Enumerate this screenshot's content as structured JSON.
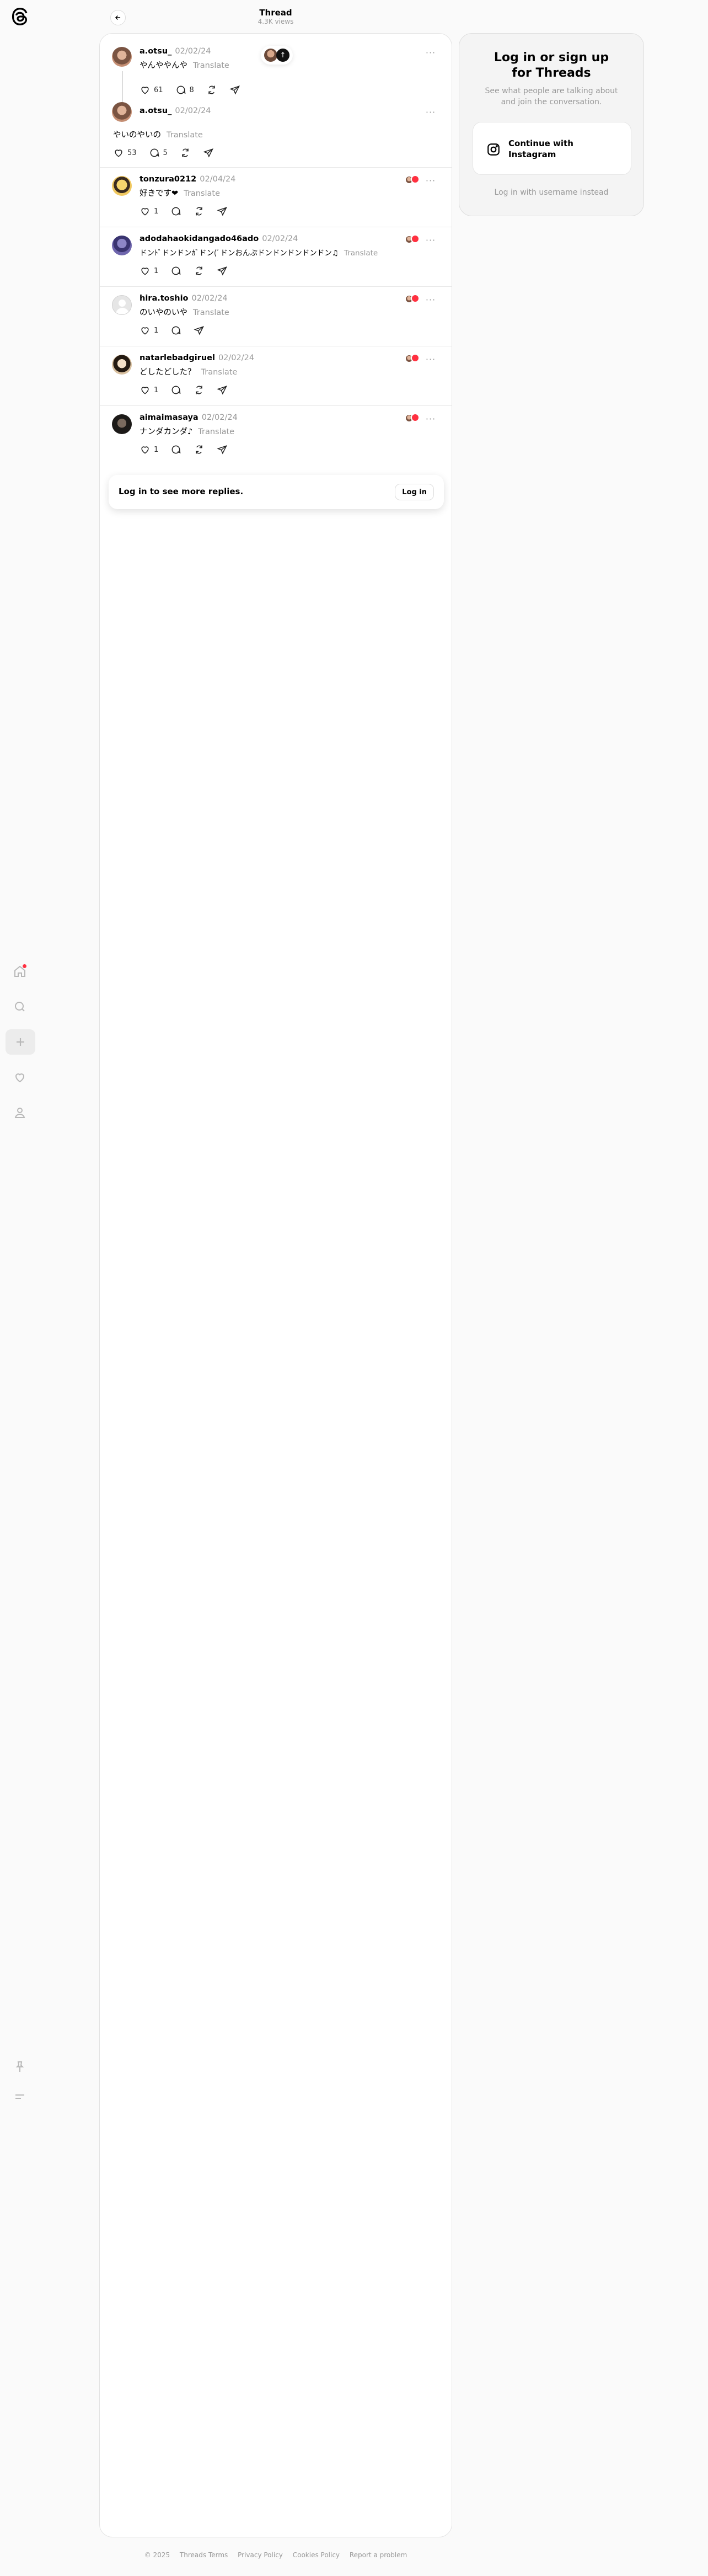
{
  "header": {
    "title": "Thread",
    "views": "4.3K views"
  },
  "nav": {
    "items": [
      {
        "name": "home-icon"
      },
      {
        "name": "search-icon"
      },
      {
        "name": "create-icon"
      },
      {
        "name": "activity-icon"
      },
      {
        "name": "profile-icon"
      }
    ],
    "bottom": [
      {
        "name": "pin-icon"
      },
      {
        "name": "menu-icon"
      }
    ]
  },
  "posts": [
    {
      "user": "a.otsu_",
      "date": "02/02/24",
      "text": "やんややんや",
      "translate": "Translate",
      "likes": "61",
      "replies": "8"
    },
    {
      "user": "a.otsu_",
      "date": "02/02/24",
      "text": "やいのやいの",
      "translate": "Translate",
      "likes": "53",
      "replies": "5"
    },
    {
      "user": "tonzura0212",
      "date": "02/04/24",
      "text": "好きです❤",
      "translate": "Translate",
      "likes": "1"
    },
    {
      "user": "adodahaokidangado46ado",
      "date": "02/02/24",
      "text": "ドンﾄﾞドンドンｶﾞドン(ﾟドンおんぷドンドンドンドンドン♫",
      "translate": "Translate",
      "likes": "1"
    },
    {
      "user": "hira.toshio",
      "date": "02/02/24",
      "text": "のいやのいや",
      "translate": "Translate",
      "likes": "1"
    },
    {
      "user": "natarlebadgiruel",
      "date": "02/02/24",
      "text": "どしたどした？",
      "translate": "Translate",
      "likes": "1"
    },
    {
      "user": "aimaimasaya",
      "date": "02/02/24",
      "text": "ナンダカンダ♪",
      "translate": "Translate",
      "likes": "1"
    }
  ],
  "more_card": {
    "text": "Log in to see more replies.",
    "button": "Log in"
  },
  "login_card": {
    "title": "Log in or sign up for Threads",
    "subtitle": "See what people are talking about and join the conversation.",
    "button": "Continue with Instagram",
    "link": "Log in with username instead"
  },
  "footer": [
    "© 2025",
    "Threads Terms",
    "Privacy Policy",
    "Cookies Policy",
    "Report a problem"
  ],
  "colors": {
    "accent_red": "#ff3040",
    "muted": "#999999",
    "card_bg": "#f4f4f4"
  }
}
